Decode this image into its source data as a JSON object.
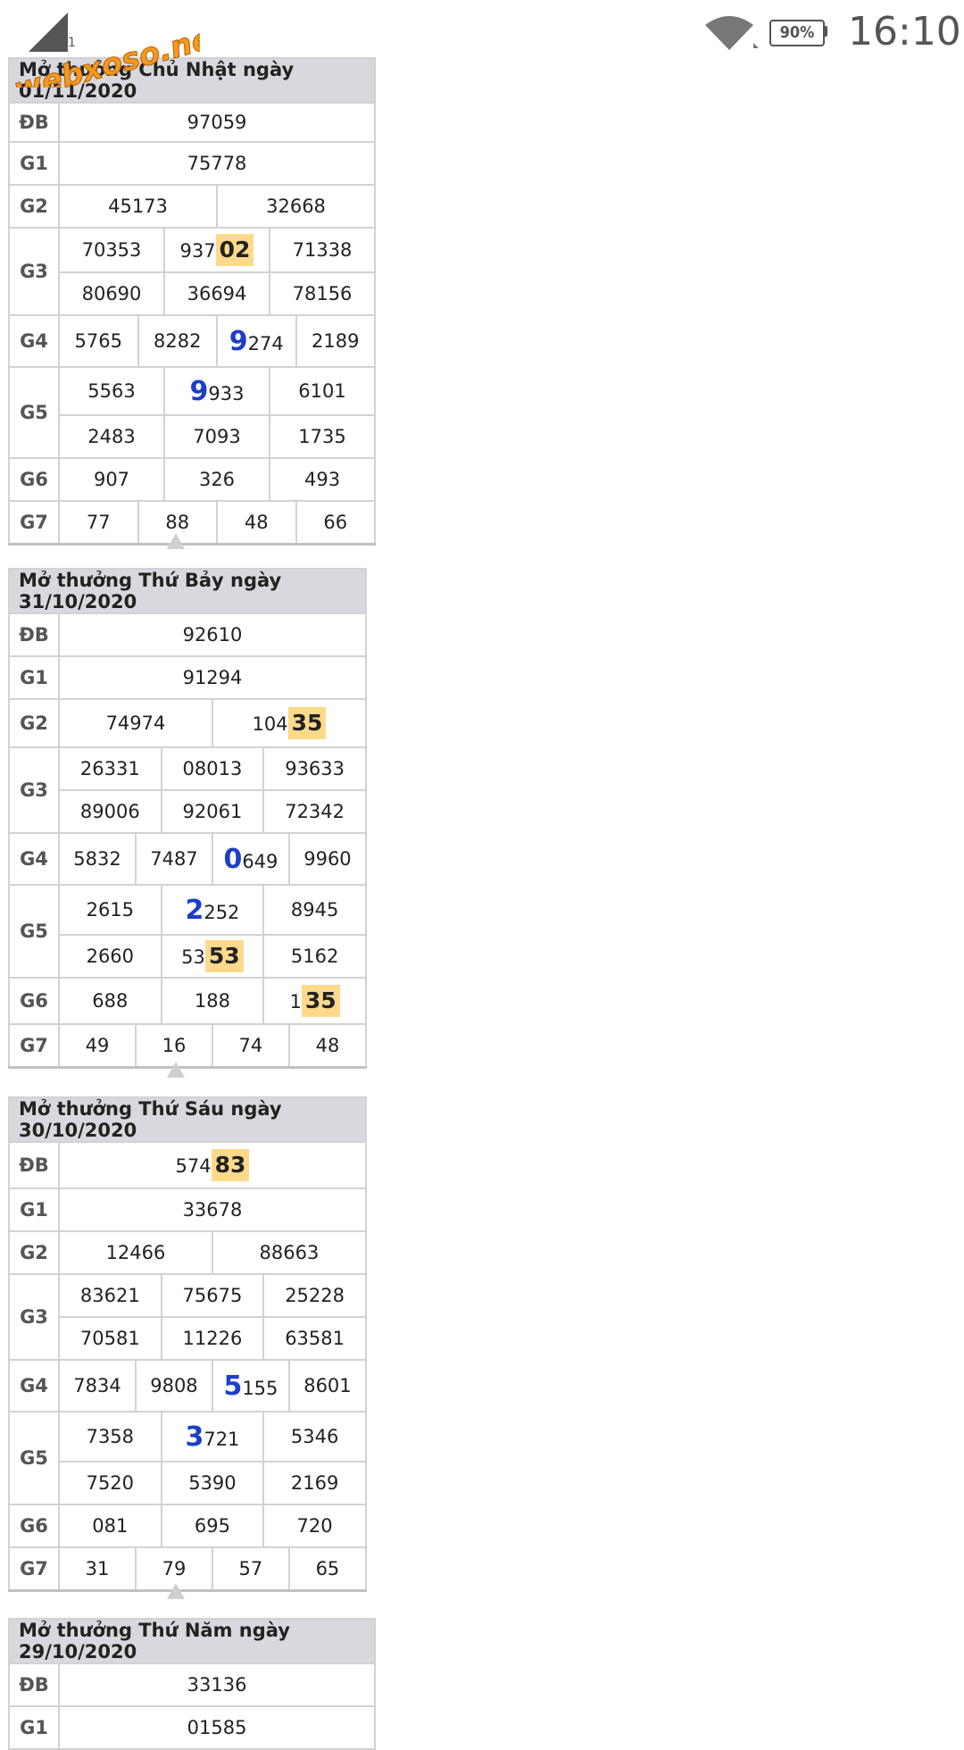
{
  "status": {
    "logo_text": "webxoso.net",
    "signal_sub": "1",
    "battery": "90%",
    "time": "16:10"
  },
  "draws": [
    {
      "title": "Mở thưởng Chủ Nhật ngày 01/11/2020",
      "rows": [
        {
          "label": "ĐB",
          "values": [
            "97059"
          ]
        },
        {
          "label": "G1",
          "values": [
            "75778"
          ]
        },
        {
          "label": "G2",
          "values": [
            "45173",
            "32668"
          ]
        },
        {
          "label": "G3",
          "values": [
            "70353",
            "93702",
            "71338"
          ]
        },
        {
          "label": "",
          "values": [
            "80690",
            "36694",
            "78156"
          ]
        },
        {
          "label": "G4",
          "values": [
            "5765",
            "8282",
            "9274",
            "2189"
          ]
        },
        {
          "label": "G5",
          "values": [
            "5563",
            "9933",
            "6101"
          ]
        },
        {
          "label": "",
          "values": [
            "2483",
            "7093",
            "1735"
          ]
        },
        {
          "label": "G6",
          "values": [
            "907",
            "326",
            "493"
          ]
        },
        {
          "label": "G7",
          "values": [
            "77",
            "88",
            "48",
            "66"
          ]
        }
      ]
    },
    {
      "title": "Mở thưởng Thứ Bảy ngày 31/10/2020",
      "rows": [
        {
          "label": "ĐB",
          "values": [
            "92610"
          ]
        },
        {
          "label": "G1",
          "values": [
            "91294"
          ]
        },
        {
          "label": "G2",
          "values": [
            "74974",
            "10435"
          ]
        },
        {
          "label": "G3",
          "values": [
            "26331",
            "08013",
            "93633"
          ]
        },
        {
          "label": "",
          "values": [
            "89006",
            "92061",
            "72342"
          ]
        },
        {
          "label": "G4",
          "values": [
            "5832",
            "7487",
            "0649",
            "9960"
          ]
        },
        {
          "label": "G5",
          "values": [
            "2615",
            "2252",
            "8945"
          ]
        },
        {
          "label": "",
          "values": [
            "2660",
            "5353",
            "5162"
          ]
        },
        {
          "label": "G6",
          "values": [
            "688",
            "188",
            "135"
          ]
        },
        {
          "label": "G7",
          "values": [
            "49",
            "16",
            "74",
            "48"
          ]
        }
      ]
    },
    {
      "title": "Mở thưởng Thứ Sáu ngày 30/10/2020",
      "rows": [
        {
          "label": "ĐB",
          "values": [
            "57483"
          ]
        },
        {
          "label": "G1",
          "values": [
            "33678"
          ]
        },
        {
          "label": "G2",
          "values": [
            "12466",
            "88663"
          ]
        },
        {
          "label": "G3",
          "values": [
            "83621",
            "75675",
            "25228"
          ]
        },
        {
          "label": "",
          "values": [
            "70581",
            "11226",
            "63581"
          ]
        },
        {
          "label": "G4",
          "values": [
            "7834",
            "9808",
            "5155",
            "8601"
          ]
        },
        {
          "label": "G5",
          "values": [
            "7358",
            "3721",
            "5346"
          ]
        },
        {
          "label": "",
          "values": [
            "7520",
            "5390",
            "2169"
          ]
        },
        {
          "label": "G6",
          "values": [
            "081",
            "695",
            "720"
          ]
        },
        {
          "label": "G7",
          "values": [
            "31",
            "79",
            "57",
            "65"
          ]
        }
      ]
    },
    {
      "title": "Mở thưởng Thứ Năm ngày 29/10/2020",
      "rows": [
        {
          "label": "ĐB",
          "values": [
            "33136"
          ]
        },
        {
          "label": "G1",
          "values": [
            "01585"
          ]
        }
      ]
    }
  ]
}
